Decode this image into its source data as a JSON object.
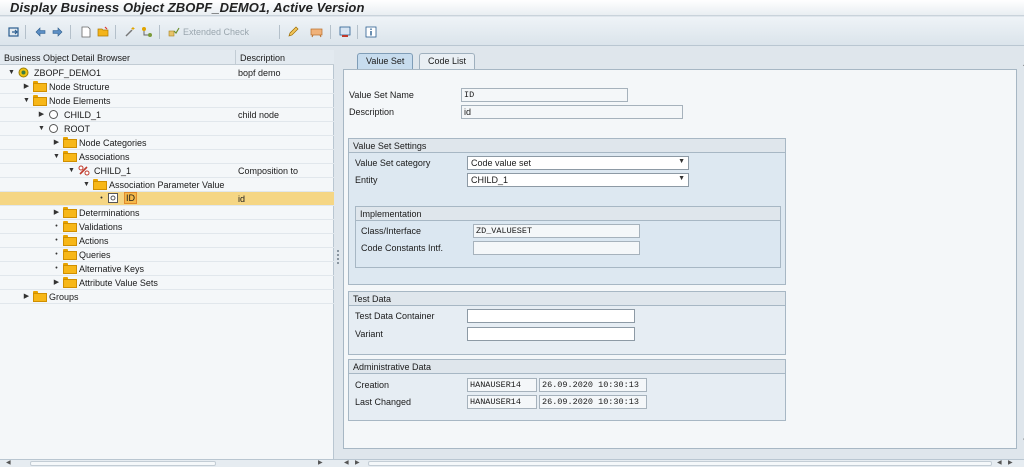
{
  "window": {
    "title": "Display Business Object ZBOPF_DEMO1, Active Version"
  },
  "toolbar": {
    "extended_check_label": "Extended Check",
    "icons": [
      "other-object-icon",
      "back-icon",
      "forward-icon",
      "new-icon",
      "open-icon",
      "magic-wand-icon",
      "hierarchy-icon",
      "check-icon",
      "edit-pencil-icon",
      "delete-icon",
      "where-used-icon",
      "info-icon"
    ]
  },
  "tree": {
    "headers": {
      "name": "Business Object Detail Browser",
      "description": "Description"
    },
    "rows": [
      {
        "label": "ZBOPF_DEMO1",
        "description": "bopf demo",
        "icon": "business-object-icon",
        "expand": "open"
      },
      {
        "label": "Node Structure",
        "description": "",
        "icon": "folder-icon",
        "expand": "closed"
      },
      {
        "label": "Node Elements",
        "description": "",
        "icon": "folder-icon",
        "expand": "open"
      },
      {
        "label": "CHILD_1",
        "description": "child node",
        "icon": "node-icon",
        "expand": "closed"
      },
      {
        "label": "ROOT",
        "description": "",
        "icon": "node-icon",
        "expand": "open"
      },
      {
        "label": "Node Categories",
        "description": "",
        "icon": "folder-icon",
        "expand": "closed"
      },
      {
        "label": "Associations",
        "description": "",
        "icon": "folder-icon",
        "expand": "open"
      },
      {
        "label": "CHILD_1",
        "description": "Composition to",
        "icon": "association-icon",
        "expand": "open"
      },
      {
        "label": "Association Parameter Value",
        "description": "",
        "icon": "folder-icon",
        "expand": "open"
      },
      {
        "label": "ID",
        "description": "id",
        "icon": "attribute-icon",
        "expand": "leaf",
        "selected": true
      },
      {
        "label": "Determinations",
        "description": "",
        "icon": "folder-icon",
        "expand": "closed"
      },
      {
        "label": "Validations",
        "description": "",
        "icon": "folder-icon",
        "expand": "leaf"
      },
      {
        "label": "Actions",
        "description": "",
        "icon": "folder-icon",
        "expand": "leaf"
      },
      {
        "label": "Queries",
        "description": "",
        "icon": "folder-icon",
        "expand": "leaf"
      },
      {
        "label": "Alternative Keys",
        "description": "",
        "icon": "folder-icon",
        "expand": "leaf"
      },
      {
        "label": "Attribute Value Sets",
        "description": "",
        "icon": "folder-icon",
        "expand": "closed"
      },
      {
        "label": "Groups",
        "description": "",
        "icon": "folder-icon",
        "expand": "closed"
      }
    ]
  },
  "tabs": [
    {
      "label": "Value Set",
      "active": true
    },
    {
      "label": "Code List",
      "active": false
    }
  ],
  "form": {
    "value_set_name_label": "Value Set Name",
    "value_set_name_value": "ID",
    "description_label": "Description",
    "description_value": "id",
    "settings": {
      "title": "Value Set Settings",
      "category_label": "Value Set category",
      "category_value": "Code value set",
      "entity_label": "Entity",
      "entity_value": "CHILD_1",
      "implementation": {
        "title": "Implementation",
        "class_label": "Class/Interface",
        "class_value": "ZD_VALUESET",
        "constants_label": "Code Constants Intf.",
        "constants_value": ""
      }
    },
    "test_data": {
      "title": "Test Data",
      "container_label": "Test Data Container",
      "container_value": "",
      "variant_label": "Variant",
      "variant_value": ""
    },
    "admin": {
      "title": "Administrative Data",
      "creation_label": "Creation",
      "creation_user": "HANAUSER14",
      "creation_time": "26.09.2020 10:30:13",
      "changed_label": "Last Changed",
      "changed_user": "HANAUSER14",
      "changed_time": "26.09.2020 10:30:13"
    }
  }
}
